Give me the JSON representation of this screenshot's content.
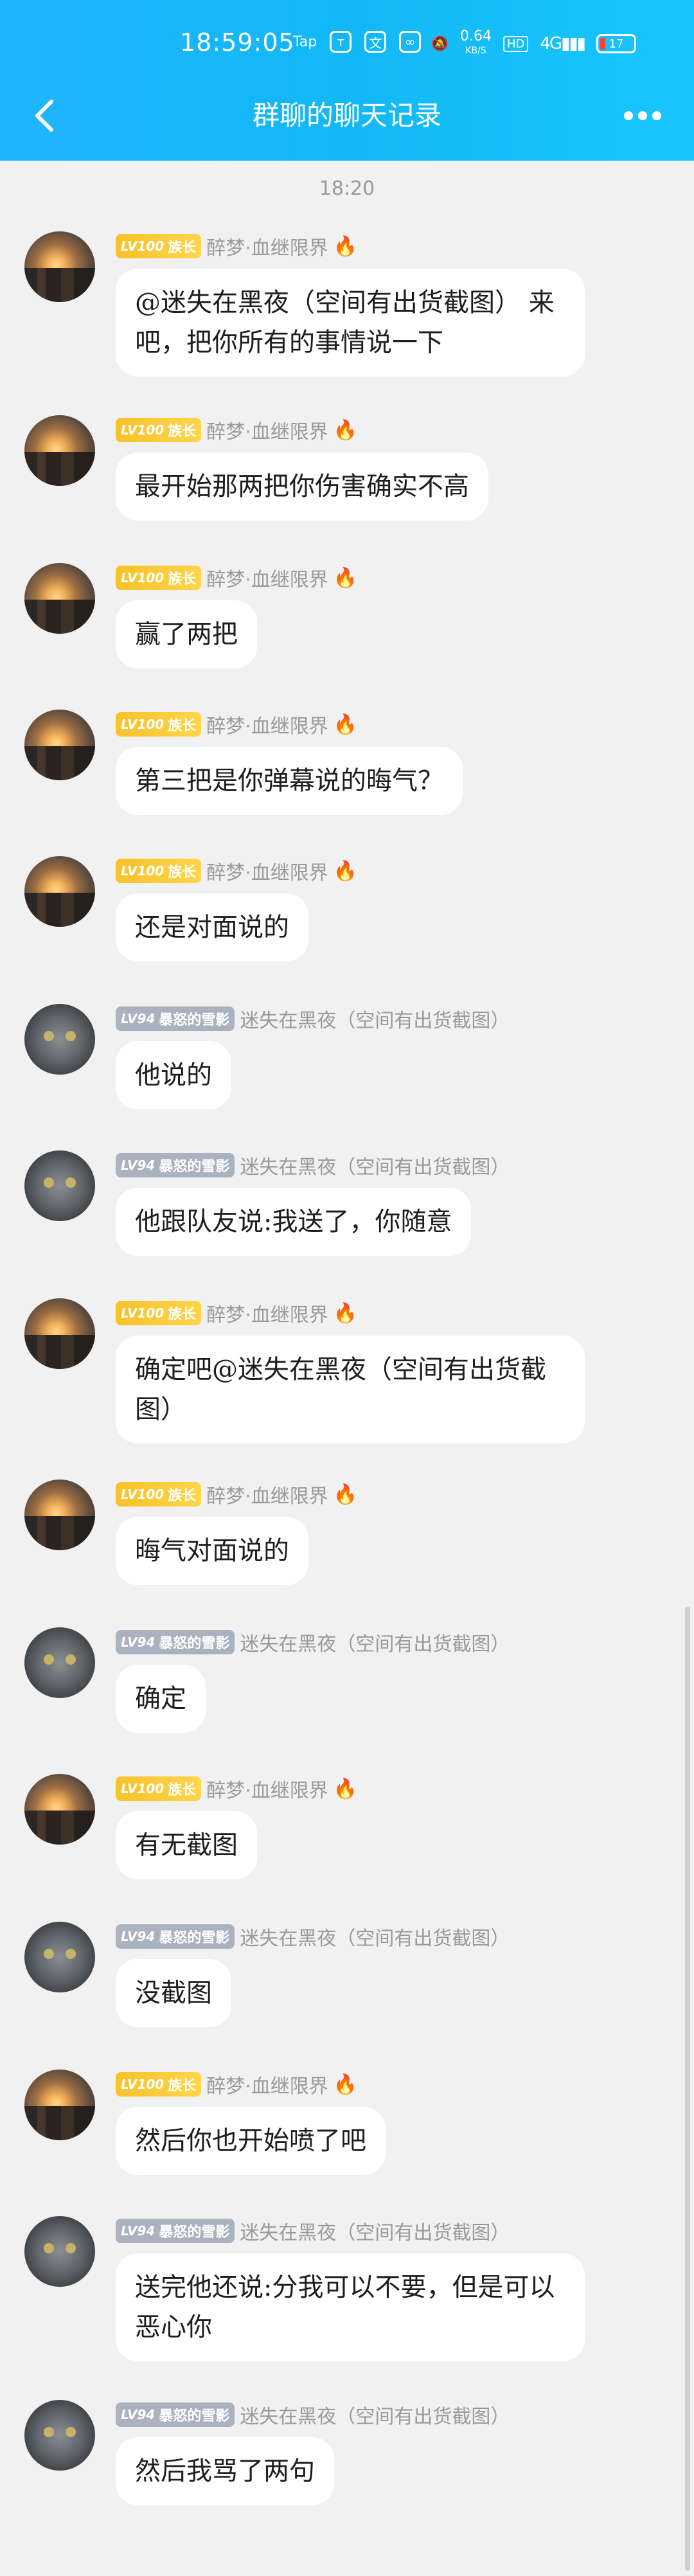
{
  "status_bar": {
    "time": "18:59:05",
    "icons": [
      "Tap",
      "т",
      "文",
      "∞"
    ],
    "net_speed": "0.64",
    "net_unit": "KB/S",
    "hd": "HD",
    "signal": "4G",
    "battery": "17"
  },
  "header": {
    "back_glyph": "‹",
    "title": "群聊的聊天记录"
  },
  "timestamp": "18:20",
  "users": {
    "a": {
      "level": "LV100",
      "title": "族长",
      "name": "醉梦·血继限界",
      "fire": "🔥"
    },
    "b": {
      "level": "LV94",
      "title": "暴怒的雪影",
      "name": "迷失在黑夜（空间有出货截图）"
    }
  },
  "messages": [
    {
      "text": "@迷失在黑夜（空间有出货截图）  来吧，把你所有的事情说一下",
      "level": "LV100",
      "title": "族长",
      "name": "醉梦·血继限界"
    },
    {
      "text": "最开始那两把你伤害确实不高",
      "level": "LV100",
      "title": "族长",
      "name": "醉梦·血继限界"
    },
    {
      "text": "赢了两把",
      "level": "LV100",
      "title": "族长",
      "name": "醉梦·血继限界"
    },
    {
      "text": "第三把是你弹幕说的晦气？",
      "level": "LV100",
      "title": "族长",
      "name": "醉梦·血继限界"
    },
    {
      "text": "还是对面说的",
      "level": "LV100",
      "title": "族长",
      "name": "醉梦·血继限界"
    },
    {
      "text": "他说的",
      "level": "LV94",
      "title": "暴怒的雪影",
      "name": "迷失在黑夜（空间有出货截图）"
    },
    {
      "text": "他跟队友说:我送了，你随意",
      "level": "LV94",
      "title": "暴怒的雪影",
      "name": "迷失在黑夜（空间有出货截图）"
    },
    {
      "text": "确定吧@迷失在黑夜（空间有出货截图）",
      "level": "LV100",
      "title": "族长",
      "name": "醉梦·血继限界"
    },
    {
      "text": "晦气对面说的",
      "level": "LV100",
      "title": "族长",
      "name": "醉梦·血继限界"
    },
    {
      "text": "确定",
      "level": "LV94",
      "title": "暴怒的雪影",
      "name": "迷失在黑夜（空间有出货截图）"
    },
    {
      "text": "有无截图",
      "level": "LV100",
      "title": "族长",
      "name": "醉梦·血继限界"
    },
    {
      "text": "没截图",
      "level": "LV94",
      "title": "暴怒的雪影",
      "name": "迷失在黑夜（空间有出货截图）"
    },
    {
      "text": "然后你也开始喷了吧",
      "level": "LV100",
      "title": "族长",
      "name": "醉梦·血继限界"
    },
    {
      "text": "送完他还说:分我可以不要，但是可以恶心你",
      "level": "LV94",
      "title": "暴怒的雪影",
      "name": "迷失在黑夜（空间有出货截图）"
    },
    {
      "text": "然后我骂了两句",
      "level": "LV94",
      "title": "暴怒的雪影",
      "name": "迷失在黑夜（空间有出货截图）"
    }
  ]
}
